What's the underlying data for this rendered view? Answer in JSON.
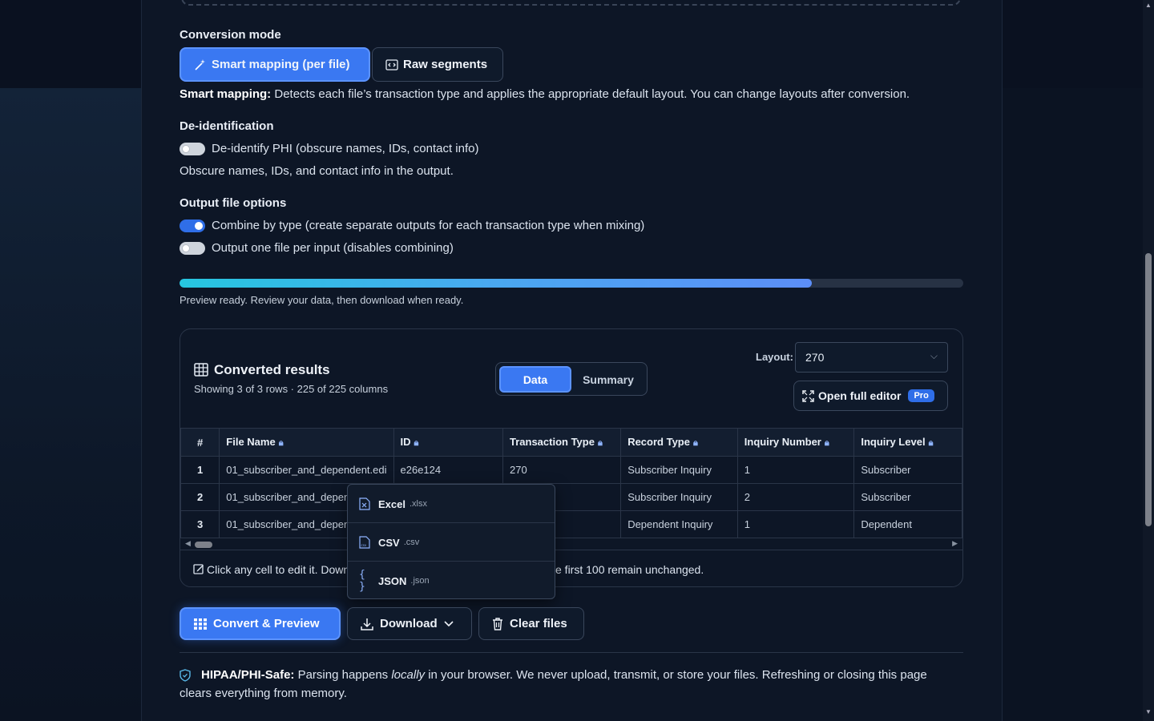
{
  "conversion_mode": {
    "title": "Conversion mode",
    "options": [
      {
        "label": "Smart mapping (per file)",
        "icon": "magic-wand-icon",
        "active": true
      },
      {
        "label": "Raw segments",
        "icon": "code-icon",
        "active": false
      }
    ],
    "description_bold": "Smart mapping:",
    "description": "Detects each file’s transaction type and applies the appropriate default layout. You can change layouts after conversion."
  },
  "deidentification": {
    "title": "De-identification",
    "toggle_label": "De-identify PHI (obscure names, IDs, contact info)",
    "toggle_on": false,
    "help": "Obscure names, IDs, and contact info in the output."
  },
  "output_options": {
    "title": "Output file options",
    "combine_label": "Combine by type (create separate outputs for each transaction type when mixing)",
    "combine_on": true,
    "per_input_label": "Output one file per input (disables combining)",
    "per_input_on": false
  },
  "progress": {
    "percent": 80.7,
    "status": "Preview ready. Review your data, then download when ready."
  },
  "results": {
    "title": "Converted results",
    "subtitle": "Showing 3 of 3 rows · 225 of 225 columns",
    "view_tabs": [
      {
        "label": "Data",
        "active": true
      },
      {
        "label": "Summary",
        "active": false
      }
    ],
    "layout_label": "Layout:",
    "layout_value": "270",
    "open_editor_label": "Open full editor",
    "pro_badge": "Pro",
    "columns": [
      "#",
      "File Name",
      "ID",
      "Transaction Type",
      "Record Type",
      "Inquiry Number",
      "Inquiry Level"
    ],
    "rows": [
      [
        "1",
        "01_subscriber_and_dependent.edi",
        "e26e124",
        "270",
        "Subscriber Inquiry",
        "1",
        "Subscriber"
      ],
      [
        "2",
        "01_subscriber_and_dependent.edi",
        "",
        "",
        "Subscriber Inquiry",
        "2",
        "Subscriber"
      ],
      [
        "3",
        "01_subscriber_and_dependent.edi",
        "",
        "",
        "Dependent Inquiry",
        "1",
        "Dependent"
      ]
    ],
    "footer_left": "Click any cell to edit it. Down",
    "footer_right": "e first 100 remain unchanged."
  },
  "download_menu": [
    {
      "name": "Excel",
      "ext": ".xlsx",
      "icon": "excel-file-icon"
    },
    {
      "name": "CSV",
      "ext": ".csv",
      "icon": "csv-file-icon"
    },
    {
      "name": "JSON",
      "ext": ".json",
      "icon": "json-braces-icon"
    }
  ],
  "actions": {
    "convert_label": "Convert & Preview",
    "download_label": "Download",
    "clear_label": "Clear files"
  },
  "notice": {
    "bold": "HIPAA/PHI-Safe:",
    "text_before": "Parsing happens",
    "emphasis": "locally",
    "text_after": "in your browser. We never upload, transmit, or store your files. Refreshing or closing this page",
    "line2": "clears everything from memory."
  },
  "colors": {
    "accent": "#3a78f2",
    "background": "#0d1626",
    "border": "#2a3548"
  }
}
